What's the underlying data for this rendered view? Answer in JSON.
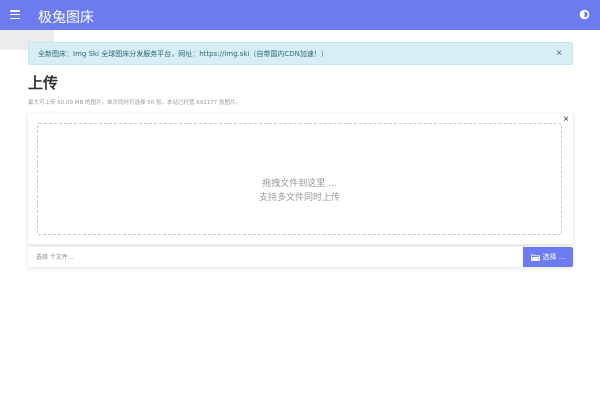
{
  "header": {
    "title": "极兔图床",
    "menu_icon": "menu-icon",
    "theme_icon": "brightness-icon",
    "bg_color": "#6c7cf0"
  },
  "notice": {
    "text": "全新图床：Img Ski 全球图床分发服务平台，网址：https://img.ski（自带国内CDN加速！）",
    "close_label": "×",
    "bg_color": "#d6eff5"
  },
  "main": {
    "title": "上传",
    "hint": "最大可上传 50.00 MB 的图片，单次同时可选择 50 张。本站已托管 692177 张图片。"
  },
  "uploader": {
    "close_label": "×",
    "drop_line1": "拖拽文件到这里 ...",
    "drop_line2": "支持多文件同时上传",
    "file_placeholder": "选择 个文件...",
    "browse_label": "选择 ..."
  }
}
